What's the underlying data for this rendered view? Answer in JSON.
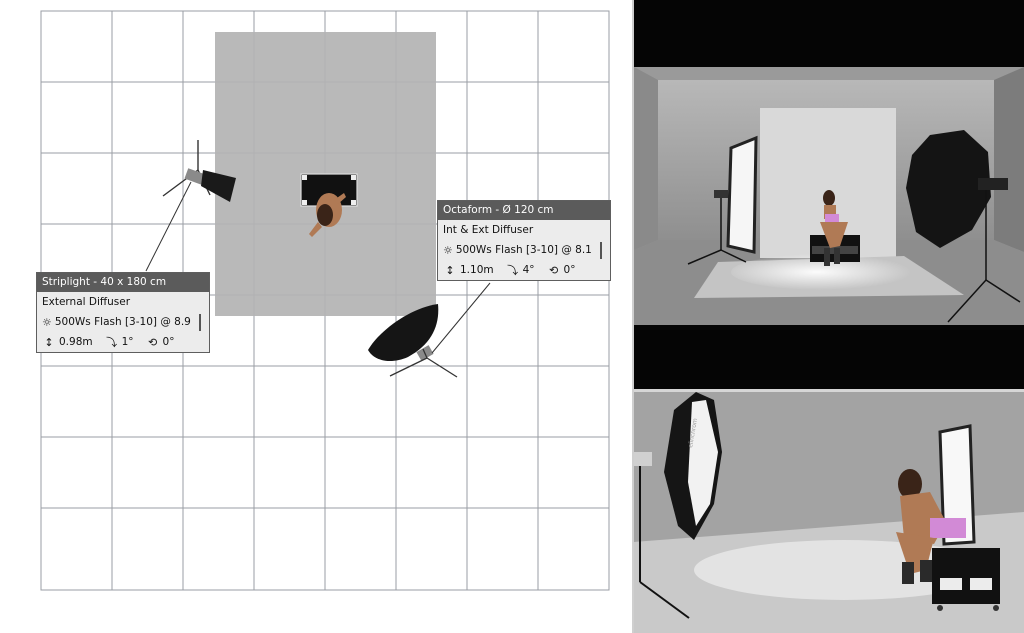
{
  "plan": {
    "striplight": {
      "title": "Striplight - 40 x 180 cm",
      "modifier": "External Diffuser",
      "flash_icon": "sun-icon",
      "flash": "500Ws Flash [3-10] @ 8.9",
      "height_icon": "height-arrows-icon",
      "height": "0.98m",
      "tilt_icon": "tilt-icon",
      "tilt": "1°",
      "rotation_icon": "rotation-icon",
      "rotation": "0°"
    },
    "octaform": {
      "title": "Octaform - Ø 120 cm",
      "modifier": "Int & Ext Diffuser",
      "flash_icon": "sun-icon",
      "flash": "500Ws Flash [3-10] @ 8.1",
      "height_icon": "height-arrows-icon",
      "height": "1.10m",
      "tilt_icon": "tilt-icon",
      "tilt": "4°",
      "rotation_icon": "rotation-icon",
      "rotation": "0°"
    }
  },
  "views": {
    "top": {
      "name": "camera-preview"
    },
    "bottom": {
      "name": "perspective-preview",
      "brand": "elinchrom"
    }
  },
  "colors": {
    "grid": "#9a9ea4",
    "backdrop": "#b3b3b3",
    "header": "#5b5b5b",
    "panel": "#ececec",
    "skin": "#b07a55",
    "outfit": "#d28ad6"
  }
}
